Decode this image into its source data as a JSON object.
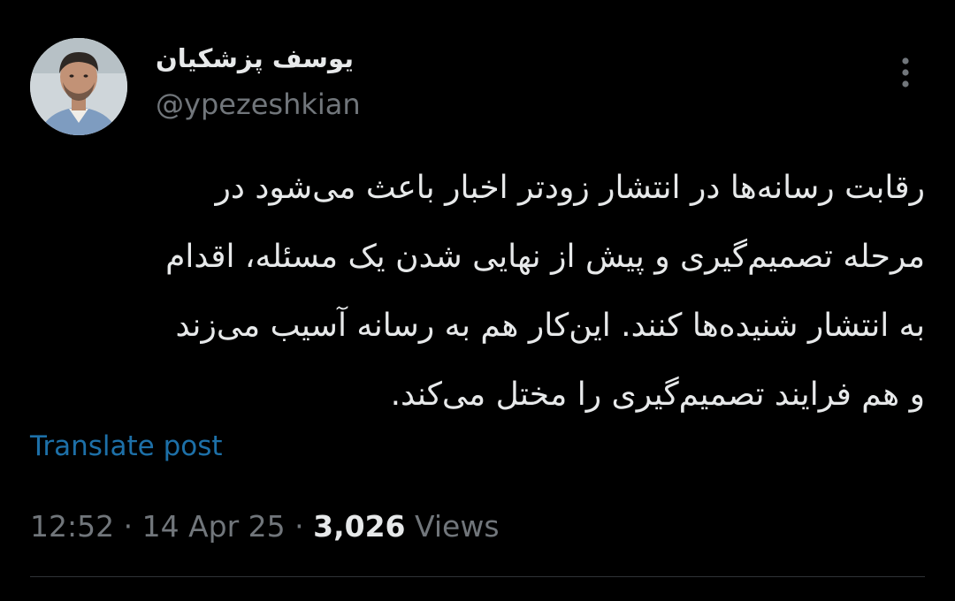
{
  "author": {
    "display_name": "یوسف پزشکیان",
    "handle": "@ypezeshkian"
  },
  "tweet": {
    "lines": [
      "رقابت رسانه‌ها در انتشار زودتر اخبار باعث می‌شود در",
      "مرحله تصمیم‌گیری و پیش از نهایی شدن یک مسئله، اقدام",
      "به انتشار  شنیده‌ها کنند. این‌کار هم به رسانه آسیب می‌زند",
      "و هم فرایند تصمیم‌گیری را مختل می‌کند."
    ]
  },
  "translate_label": "Translate post",
  "meta": {
    "time": "12:52",
    "separator": " · ",
    "date": "14 Apr 25",
    "views_count": "3,026",
    "views_label": " Views"
  },
  "icons": {
    "more": "more-vertical-icon"
  },
  "colors": {
    "background": "#000000",
    "primary_text": "#e7e9ea",
    "secondary_text": "#71767b",
    "link": "#1d70a8",
    "divider": "#2f3336"
  }
}
